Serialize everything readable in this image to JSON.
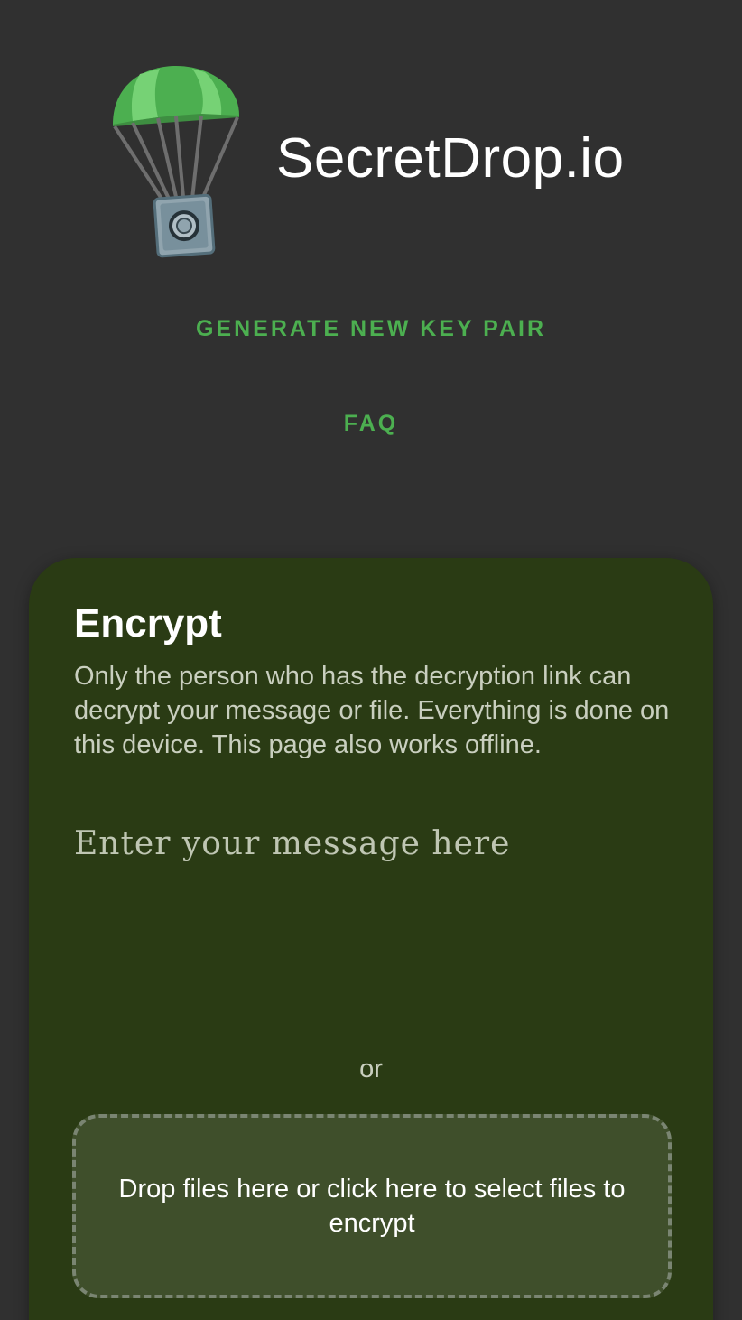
{
  "header": {
    "title": "SecretDrop.io"
  },
  "nav": {
    "generate_key_pair": "GENERATE NEW KEY PAIR",
    "faq": "FAQ"
  },
  "encrypt": {
    "title": "Encrypt",
    "description": "Only the person who has the decryption link can decrypt your message or file. Everything is done on this device. This page also works offline.",
    "message_placeholder": "Enter your message here",
    "message_value": "",
    "or_label": "or",
    "dropzone_label": "Drop files here or click here to select files to encrypt"
  },
  "colors": {
    "background": "#303030",
    "accent": "#4caf50",
    "card": "#2a3b14",
    "dropzone": "#3f4f2b"
  },
  "icons": {
    "logo": "parachute-safe-icon"
  }
}
